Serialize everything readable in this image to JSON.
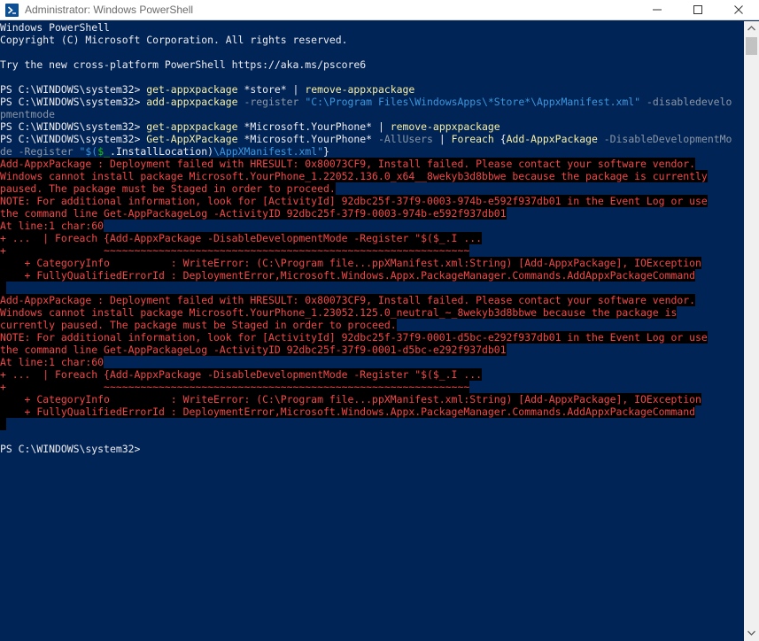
{
  "window": {
    "title": "Administrator: Windows PowerShell",
    "app_icon": "powershell-icon",
    "controls": [
      "minimize-icon",
      "maximize-icon",
      "close-icon"
    ]
  },
  "colors": {
    "background": "#012456",
    "text": "#eeedf0",
    "error": "#f44747",
    "command": "#f9f1a5",
    "parameter": "#8a96a6",
    "string": "#3a96dd",
    "variable": "#16c60c"
  },
  "console": {
    "lines": [
      {
        "type": "plain",
        "segments": [
          {
            "t": "Windows PowerShell",
            "c": "plain"
          }
        ]
      },
      {
        "type": "plain",
        "segments": [
          {
            "t": "Copyright (C) Microsoft Corporation. All rights reserved.",
            "c": "plain"
          }
        ]
      },
      {
        "type": "plain",
        "segments": [
          {
            "t": "",
            "c": "plain"
          }
        ]
      },
      {
        "type": "plain",
        "segments": [
          {
            "t": "Try the new cross-platform PowerShell https://aka.ms/pscore6",
            "c": "plain"
          }
        ]
      },
      {
        "type": "plain",
        "segments": [
          {
            "t": "",
            "c": "plain"
          }
        ]
      },
      {
        "type": "plain",
        "segments": [
          {
            "t": "PS C:\\WINDOWS\\system32> ",
            "c": "plain"
          },
          {
            "t": "get-appxpackage",
            "c": "cmd"
          },
          {
            "t": " *store* ",
            "c": "plain"
          },
          {
            "t": "| ",
            "c": "plain"
          },
          {
            "t": "remove-appxpackage",
            "c": "cmd"
          }
        ]
      },
      {
        "type": "plain",
        "segments": [
          {
            "t": "PS C:\\WINDOWS\\system32> ",
            "c": "plain"
          },
          {
            "t": "add-appxpackage",
            "c": "cmd"
          },
          {
            "t": " -register ",
            "c": "param"
          },
          {
            "t": "\"C:\\Program Files\\WindowsApps\\*Store*\\AppxManifest.xml\"",
            "c": "str"
          },
          {
            "t": " -disabledevelo",
            "c": "param"
          }
        ]
      },
      {
        "type": "plain",
        "segments": [
          {
            "t": "pmentmode",
            "c": "param"
          }
        ]
      },
      {
        "type": "plain",
        "segments": [
          {
            "t": "PS C:\\WINDOWS\\system32> ",
            "c": "plain"
          },
          {
            "t": "get-appxpackage",
            "c": "cmd"
          },
          {
            "t": " *Microsoft.YourPhone* ",
            "c": "plain"
          },
          {
            "t": "| ",
            "c": "plain"
          },
          {
            "t": "remove-appxpackage",
            "c": "cmd"
          }
        ]
      },
      {
        "type": "plain",
        "segments": [
          {
            "t": "PS C:\\WINDOWS\\system32> ",
            "c": "plain"
          },
          {
            "t": "Get-AppXPackage",
            "c": "cmd"
          },
          {
            "t": " *Microsoft.YourPhone* ",
            "c": "plain"
          },
          {
            "t": "-AllUsers ",
            "c": "param"
          },
          {
            "t": "| ",
            "c": "plain"
          },
          {
            "t": "Foreach ",
            "c": "cmd"
          },
          {
            "t": "{",
            "c": "plain"
          },
          {
            "t": "Add-AppxPackage",
            "c": "cmd"
          },
          {
            "t": " -DisableDevelopmentMo",
            "c": "param"
          }
        ]
      },
      {
        "type": "plain",
        "segments": [
          {
            "t": "de -Register ",
            "c": "param"
          },
          {
            "t": "\"$(",
            "c": "str"
          },
          {
            "t": "$_",
            "c": "var"
          },
          {
            "t": ".InstallLocation)",
            "c": "plain"
          },
          {
            "t": "\\AppXManifest.xml\"",
            "c": "str"
          },
          {
            "t": "}",
            "c": "plain"
          }
        ]
      },
      {
        "type": "err",
        "text": "Add-AppxPackage : Deployment failed with HRESULT: 0x80073CF9, Install failed. Please contact your software vendor."
      },
      {
        "type": "err",
        "text": "Windows cannot install package Microsoft.YourPhone_1.22052.136.0_x64__8wekyb3d8bbwe because the package is currently"
      },
      {
        "type": "err",
        "text": "paused. The package must be Staged in order to proceed."
      },
      {
        "type": "err",
        "text": "NOTE: For additional information, look for [ActivityId] 92dbc25f-37f9-0003-974b-e592f937db01 in the Event Log or use"
      },
      {
        "type": "err",
        "text": "the command line Get-AppPackageLog -ActivityID 92dbc25f-37f9-0003-974b-e592f937db01"
      },
      {
        "type": "err",
        "text": "At line:1 char:60"
      },
      {
        "type": "err",
        "text": "+ ...  | Foreach {Add-AppxPackage -DisableDevelopmentMode -Register \"$($_.I ..."
      },
      {
        "type": "err",
        "text": "+                ~~~~~~~~~~~~~~~~~~~~~~~~~~~~~~~~~~~~~~~~~~~~~~~~~~~~~~~~~~~~"
      },
      {
        "type": "err",
        "text": "    + CategoryInfo          : WriteError: (C:\\Program file...ppXManifest.xml:String) [Add-AppxPackage], IOException"
      },
      {
        "type": "err",
        "text": "    + FullyQualifiedErrorId : DeploymentError,Microsoft.Windows.Appx.PackageManager.Commands.AddAppxPackageCommand"
      },
      {
        "type": "err",
        "text": " "
      },
      {
        "type": "err",
        "text": "Add-AppxPackage : Deployment failed with HRESULT: 0x80073CF9, Install failed. Please contact your software vendor."
      },
      {
        "type": "err",
        "text": "Windows cannot install package Microsoft.YourPhone_1.23052.125.0_neutral_~_8wekyb3d8bbwe because the package is"
      },
      {
        "type": "err",
        "text": "currently paused. The package must be Staged in order to proceed."
      },
      {
        "type": "err",
        "text": "NOTE: For additional information, look for [ActivityId] 92dbc25f-37f9-0001-d5bc-e292f937db01 in the Event Log or use"
      },
      {
        "type": "err",
        "text": "the command line Get-AppPackageLog -ActivityID 92dbc25f-37f9-0001-d5bc-e292f937db01"
      },
      {
        "type": "err",
        "text": "At line:1 char:60"
      },
      {
        "type": "err",
        "text": "+ ...  | Foreach {Add-AppxPackage -DisableDevelopmentMode -Register \"$($_.I ..."
      },
      {
        "type": "err",
        "text": "+                ~~~~~~~~~~~~~~~~~~~~~~~~~~~~~~~~~~~~~~~~~~~~~~~~~~~~~~~~~~~~"
      },
      {
        "type": "err",
        "text": "    + CategoryInfo          : WriteError: (C:\\Program file...ppXManifest.xml:String) [Add-AppxPackage], IOException"
      },
      {
        "type": "err",
        "text": "    + FullyQualifiedErrorId : DeploymentError,Microsoft.Windows.Appx.PackageManager.Commands.AddAppxPackageCommand"
      },
      {
        "type": "err",
        "text": " "
      },
      {
        "type": "plain",
        "segments": [
          {
            "t": "",
            "c": "plain"
          }
        ]
      },
      {
        "type": "plain",
        "segments": [
          {
            "t": "PS C:\\WINDOWS\\system32>",
            "c": "plain"
          }
        ]
      }
    ]
  }
}
